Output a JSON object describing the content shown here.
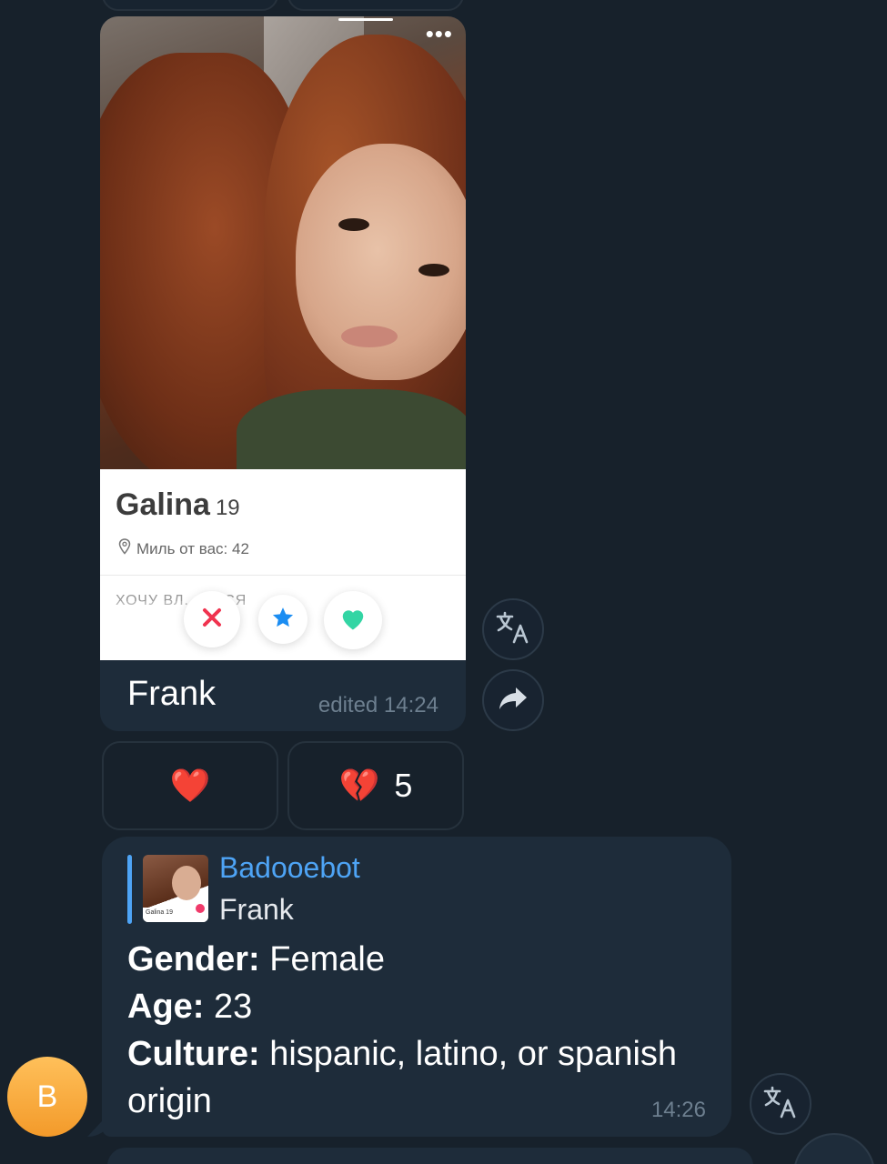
{
  "profile_card": {
    "name": "Galina",
    "age": "19",
    "location_label": "Миль от вас: 42",
    "bio_partial": "ХОЧУ ВЛ... ТЬСЯ",
    "more_dots": "•••"
  },
  "photo_message": {
    "caption": "Frank",
    "edited_label": "edited 14:24"
  },
  "reactions": {
    "heart_emoji": "❤️",
    "broken_heart_emoji": "💔",
    "broken_heart_count": "5"
  },
  "reply_message": {
    "quote_sender": "Badooebot",
    "quote_text": "Frank",
    "thumb_name": "Galina 19",
    "gender_label": "Gender:",
    "gender_value": "Female",
    "age_label": "Age:",
    "age_value": "23",
    "culture_label": "Culture:",
    "culture_value_line1": "hispanic, latino, or spanish",
    "culture_value_line2": "origin",
    "time": "14:26"
  },
  "avatar": {
    "initial": "B",
    "color": "#f7a93a"
  },
  "colors": {
    "background": "#17212b",
    "bubble": "#1e2c3a",
    "link": "#4ea4f5",
    "meta": "#6d7f8f"
  },
  "icons": [
    "translate-icon",
    "share-icon",
    "download-icon",
    "close-icon",
    "star-icon",
    "heart-icon",
    "location-pin-icon"
  ]
}
